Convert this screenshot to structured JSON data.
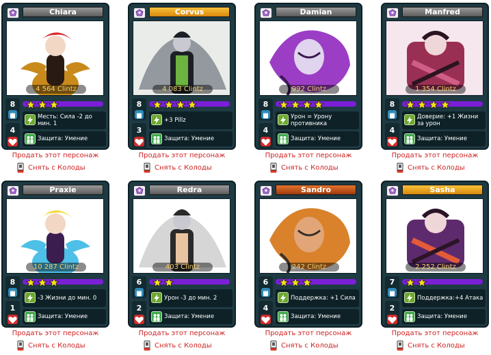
{
  "cards": [
    {
      "name": "Chiara",
      "name_color": "gray",
      "price": "4 564 Clintz",
      "power": "8",
      "damage": "4",
      "stars": 3,
      "ability": "Месть: Сила -2 до мин. 1",
      "bonus": "Защита: Умение",
      "art": {
        "bg": "#ffffff",
        "main": "#c98a1b",
        "accent": "#d8262b",
        "dark": "#2a1a14"
      }
    },
    {
      "name": "Corvus",
      "name_color": "gold",
      "price": "4 083 Clintz",
      "power": "8",
      "damage": "3",
      "stars": 4,
      "ability": "+3 Pillz",
      "bonus": "Защита: Умение",
      "art": {
        "bg": "#e9ece8",
        "main": "#4d5560",
        "accent": "#6db33f",
        "dark": "#1c2026"
      }
    },
    {
      "name": "Damian",
      "name_color": "gray",
      "price": "992 Clintz",
      "power": "8",
      "damage": "4",
      "stars": 4,
      "ability": "Урон = Урону противника",
      "bonus": "Защита: Умение",
      "art": {
        "bg": "#ffffff",
        "main": "#9b3ec5",
        "accent": "#e0d4ee",
        "dark": "#3a1a52"
      }
    },
    {
      "name": "Manfred",
      "name_color": "gray",
      "price": "1 354 Clintz",
      "power": "8",
      "damage": "4",
      "stars": 4,
      "ability": "Доверие: +1 Жизни за урон",
      "bonus": "Защита: Умение",
      "art": {
        "bg": "#f6e6ee",
        "main": "#9a2f54",
        "accent": "#d05d86",
        "dark": "#2a1420"
      }
    },
    {
      "name": "Praxie",
      "name_color": "gray",
      "price": "10 287 Clintz",
      "power": "8",
      "damage": "1",
      "stars": 3,
      "ability": "-3 Жизни до мин. 0",
      "bonus": "Защита: Умение",
      "art": {
        "bg": "#ffffff",
        "main": "#4ec0e8",
        "accent": "#f3da3a",
        "dark": "#3b1e4f"
      }
    },
    {
      "name": "Redra",
      "name_color": "gray",
      "price": "403 Clintz",
      "power": "6",
      "damage": "2",
      "stars": 2,
      "ability": "Урон -3 до мин. 2",
      "bonus": "Защита: Умение",
      "art": {
        "bg": "#ffffff",
        "main": "#b5b5b5",
        "accent": "#e8c4a0",
        "dark": "#2a2a2a"
      }
    },
    {
      "name": "Sandro",
      "name_color": "orange",
      "price": "242 Clintz",
      "power": "6",
      "damage": "4",
      "stars": 3,
      "ability": "Поддержка: +1 Сила",
      "bonus": "Защита: Умение",
      "art": {
        "bg": "#ffffff",
        "main": "#d9822b",
        "accent": "#e2a577",
        "dark": "#35302c"
      }
    },
    {
      "name": "Sasha",
      "name_color": "gold",
      "price": "2 252 Clintz",
      "power": "7",
      "damage": "2",
      "stars": 2,
      "ability": "Поддержка:+4 Атака",
      "bonus": "Защита: Умение",
      "art": {
        "bg": "#ffffff",
        "main": "#5e2a6e",
        "accent": "#e45b3a",
        "dark": "#2a1426"
      }
    }
  ],
  "sell_label": "Продать этот персонаж",
  "remove_label": "Снять с Колоды",
  "colors": {
    "link": "#cc1f1f",
    "stars_bar": "#7b1fd6",
    "star": "#f4e21c"
  }
}
